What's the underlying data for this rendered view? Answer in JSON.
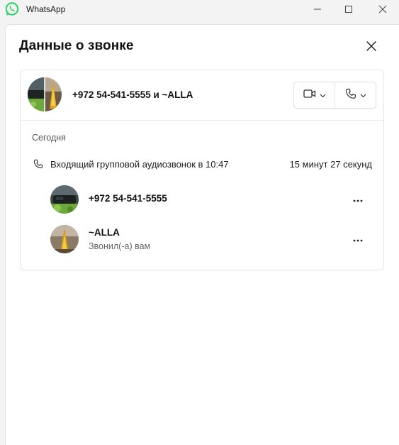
{
  "app": {
    "title": "WhatsApp",
    "brand_color": "#25D366"
  },
  "window_controls": {
    "minimize": "minimize-icon",
    "maximize": "maximize-icon",
    "close": "close-icon"
  },
  "dialog": {
    "title": "Данные о звонке",
    "close_icon": "close-icon",
    "group_name": "+972 54-541-5555 и ~ALLA",
    "actions": [
      {
        "icon": "video-call-icon",
        "dropdown_icon": "chevron-down-icon"
      },
      {
        "icon": "voice-call-icon",
        "dropdown_icon": "chevron-down-icon"
      }
    ],
    "section_label": "Сегодня",
    "call": {
      "icon": "phone-icon",
      "description": "Входящий групповой аудиозвонок в 10:47",
      "duration": "15 минут 27 секунд"
    },
    "participants": [
      {
        "name": "+972 54-541-5555",
        "subtitle": "",
        "more_icon": "more-options-icon"
      },
      {
        "name": "~ALLA",
        "subtitle": "Звонил(-а) вам",
        "more_icon": "more-options-icon"
      }
    ]
  }
}
